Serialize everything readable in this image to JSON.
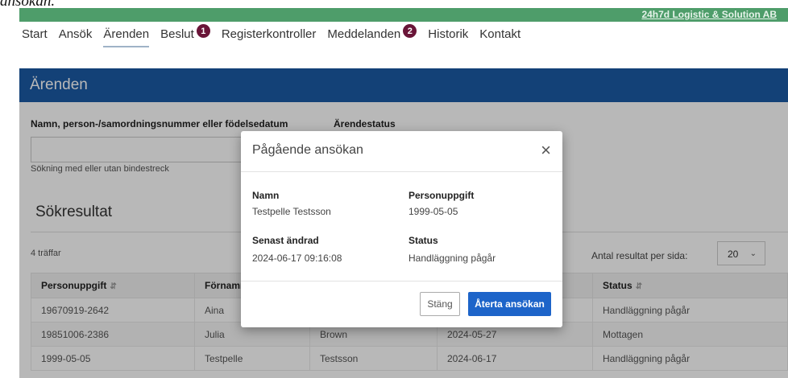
{
  "caption": "ansökan.",
  "topbar": {
    "company": "24h7d Logistic & Solution AB"
  },
  "nav": {
    "items": [
      {
        "label": "Start"
      },
      {
        "label": "Ansök"
      },
      {
        "label": "Ärenden"
      },
      {
        "label": "Beslut",
        "badge": "1"
      },
      {
        "label": "Registerkontroller"
      },
      {
        "label": "Meddelanden",
        "badge": "2"
      },
      {
        "label": "Historik"
      },
      {
        "label": "Kontakt"
      }
    ]
  },
  "page": {
    "title": "Ärenden",
    "search_label": "Namn, person-/samordningsnummer eller födelsedatum",
    "status_label": "Ärendestatus",
    "search_value": "",
    "search_hint": "Sökning med eller utan bindestreck",
    "results_title": "Sökresultat",
    "hits": "4 träffar",
    "per_page_label": "Antal resultat per sida:",
    "per_page_value": "20"
  },
  "table": {
    "headers": [
      "Personuppgift",
      "Förnamn",
      "",
      "",
      "Status"
    ],
    "rows": [
      [
        "19670919-2642",
        "Aina",
        "",
        "",
        "Handläggning pågår"
      ],
      [
        "19851006-2386",
        "Julia",
        "Brown",
        "2024-05-27",
        "Mottagen"
      ],
      [
        "1999-05-05",
        "Testpelle",
        "Testsson",
        "2024-06-17",
        "Handläggning pågår"
      ]
    ]
  },
  "modal": {
    "title": "Pågående ansökan",
    "close_icon": "×",
    "name_label": "Namn",
    "name_value": "Testpelle Testsson",
    "person_label": "Personuppgift",
    "person_value": "1999-05-05",
    "changed_label": "Senast ändrad",
    "changed_value": "2024-06-17 09:16:08",
    "status_label": "Status",
    "status_value": "Handläggning pågår",
    "close_button": "Stäng",
    "primary_button": "Återta ansökan"
  },
  "colors": {
    "topbar": "#4e9d6a",
    "header": "#1b5aa6",
    "badge": "#6a1538",
    "primary": "#1d64c9"
  }
}
